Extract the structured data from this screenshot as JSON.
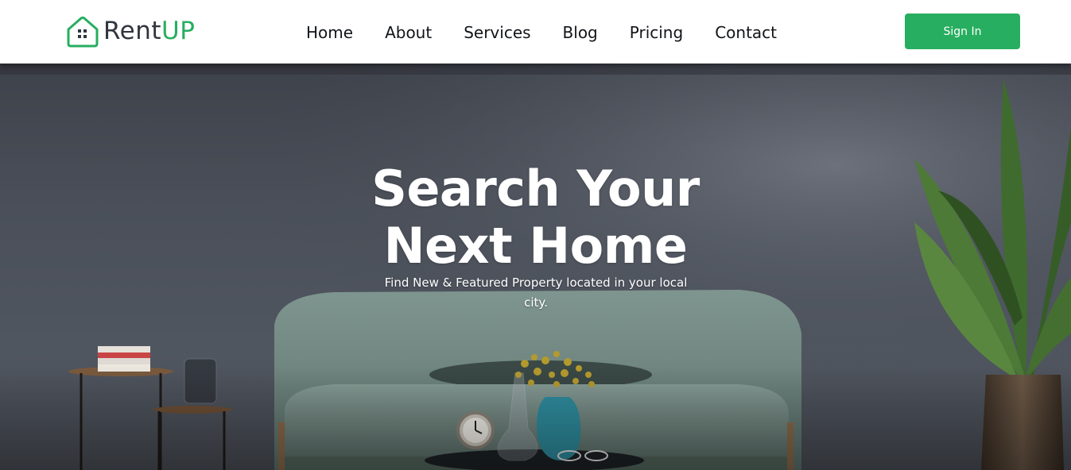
{
  "brand": {
    "name_part1": "Rent",
    "name_part2": "UP",
    "accent_color": "#27ae60",
    "logo_icon": "house-icon"
  },
  "nav": {
    "items": [
      {
        "label": "Home"
      },
      {
        "label": "About"
      },
      {
        "label": "Services"
      },
      {
        "label": "Blog"
      },
      {
        "label": "Pricing"
      },
      {
        "label": "Contact"
      }
    ]
  },
  "header": {
    "signin_label": "Sign In"
  },
  "hero": {
    "title_line1": "Search Your",
    "title_line2": "Next Home",
    "subtitle": "Find New & Featured Property located in your local city."
  }
}
